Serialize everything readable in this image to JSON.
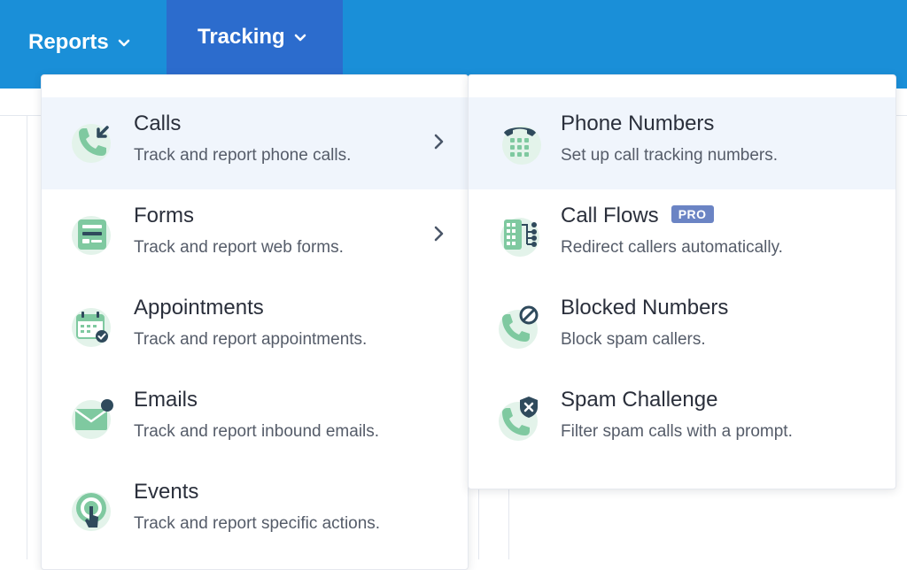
{
  "nav": {
    "reports_label": "Reports",
    "tracking_label": "Tracking"
  },
  "left_menu": [
    {
      "title": "Calls",
      "desc": "Track and report phone calls.",
      "icon": "phone-incoming-icon",
      "has_submenu": true,
      "active": true
    },
    {
      "title": "Forms",
      "desc": "Track and report web forms.",
      "icon": "form-icon",
      "has_submenu": true,
      "active": false
    },
    {
      "title": "Appointments",
      "desc": "Track and report appointments.",
      "icon": "calendar-check-icon",
      "has_submenu": false,
      "active": false
    },
    {
      "title": "Emails",
      "desc": "Track and report inbound emails.",
      "icon": "envelope-icon",
      "has_submenu": false,
      "active": false
    },
    {
      "title": "Events",
      "desc": "Track and report specific actions.",
      "icon": "tap-target-icon",
      "has_submenu": false,
      "active": false
    }
  ],
  "right_menu": [
    {
      "title": "Phone Numbers",
      "desc": "Set up call tracking numbers.",
      "icon": "desk-phone-icon",
      "active": true
    },
    {
      "title": "Call Flows",
      "badge": "PRO",
      "desc": "Redirect callers automatically.",
      "icon": "call-flow-icon",
      "active": false
    },
    {
      "title": "Blocked Numbers",
      "desc": "Block spam callers.",
      "icon": "phone-blocked-icon",
      "active": false
    },
    {
      "title": "Spam Challenge",
      "desc": "Filter spam calls with a prompt.",
      "icon": "phone-shield-icon",
      "active": false
    }
  ],
  "colors": {
    "topbar": "#1a8fd8",
    "tracking_active": "#2c6ccd",
    "icon_green": "#7fc9a0",
    "icon_dark": "#2f4a5c",
    "badge": "#6b84c4"
  }
}
